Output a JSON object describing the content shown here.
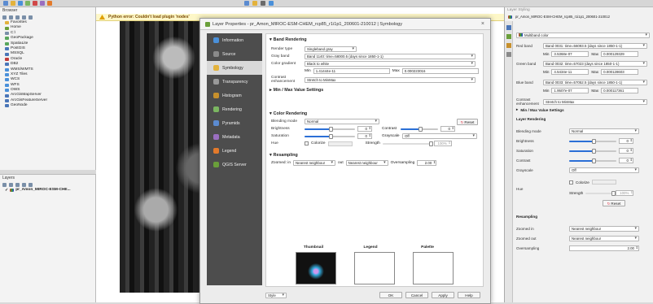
{
  "error_bar": {
    "text": "Python error: Couldn't load plugin 'nodes'"
  },
  "browser": {
    "title": "Browser",
    "items": [
      "Favorites",
      "Home",
      "C:\\",
      "GeoPackage",
      "SpatiaLite",
      "PostGIS",
      "MSSQL",
      "Oracle",
      "DB2",
      "WMS/WMTS",
      "XYZ Tiles",
      "WCS",
      "WFS",
      "OWS",
      "ArcGisMapServer",
      "ArcGisFeatureServer",
      "GeoNode"
    ]
  },
  "layers": {
    "title": "Layers",
    "layer_name": "pr_Amon_MIROC-ESM-CHE..."
  },
  "dialog": {
    "title": "Layer Properties - pr_Amon_MIROC-ESM-CHEM_rcp85_r1i1p1_200601-210012 | Symbology",
    "close": "×",
    "sidebar": [
      "Information",
      "Source",
      "Symbology",
      "Transparency",
      "Histogram",
      "Rendering",
      "Pyramids",
      "Metadata",
      "Legend",
      "QGIS Server"
    ],
    "band_rendering": {
      "header": "Band Rendering",
      "render_type_label": "Render type",
      "render_type": "Singleband gray",
      "gray_band_label": "Gray band",
      "gray_band": "Band 1140: time=58000.5 (days since 1850-1-1)",
      "color_gradient_label": "Color gradient",
      "color_gradient": "Black to white",
      "min_label": "Min",
      "min": "1.41444e-11",
      "max_label": "Max",
      "max": "0.000223016",
      "contrast_label": "Contrast enhancement",
      "contrast": "Stretch to MinMax"
    },
    "minmax": {
      "header": "Min / Max Value Settings"
    },
    "color_rendering": {
      "header": "Color Rendering",
      "blend_label": "Blending mode",
      "blend": "Normal",
      "reset": "Reset",
      "brightness_label": "Brightness",
      "brightness": "0",
      "contrast_label": "Contrast",
      "contrast": "0",
      "saturation_label": "Saturation",
      "saturation": "0",
      "grayscale_label": "Grayscale",
      "grayscale": "Off",
      "hue_label": "Hue",
      "colorize_label": "Colorize",
      "strength_label": "Strength",
      "strength": "100%"
    },
    "resampling": {
      "header": "Resampling",
      "zoomed_in_label": "Zoomed: in",
      "zoomed_in": "Nearest neighbour",
      "zoomed_out_label": "out",
      "zoomed_out": "Nearest neighbour",
      "oversampling_label": "Oversampling",
      "oversampling": "2.00"
    },
    "previews": {
      "thumbnail": "Thumbnail",
      "legend": "Legend",
      "palette": "Palette"
    },
    "footer": {
      "style": "Style",
      "ok": "OK",
      "cancel": "Cancel",
      "apply": "Apply",
      "help": "Help"
    }
  },
  "style_panel": {
    "title": "Layer Styling",
    "layer": "pr_Amon_MIROC-ESM-CHEM_rcp85_r1i1p1_200601-210012",
    "renderer": "Multiband color",
    "red_band_label": "Red band",
    "red_band": "Band 0031: time=56093.5 (days since 1850-1-1)",
    "red_min_label": "Min",
    "red_min": "3.5368e-07",
    "red_max_label": "Max",
    "red_max": "0.000129329",
    "green_band_label": "Green band",
    "green_band": "Band 0032: time=57023 (days since 1850-1-1)",
    "green_min_label": "Min",
    "green_min": "4.5434e-11",
    "green_max_label": "Max",
    "green_max": "0.000128603",
    "blue_band_label": "Blue band",
    "blue_band": "Band 0033: time=57052.5 (days since 1850-1-1)",
    "blue_min_label": "Min",
    "blue_min": "1.9507e-07",
    "blue_max_label": "Max",
    "blue_max": "0.000117361",
    "contrast_label": "Contrast enhancement",
    "contrast": "Stretch to MinMax",
    "minmax_header": "Min / Max Value Settings",
    "layer_rendering_header": "Layer Rendering",
    "blend_label": "Blending mode",
    "blend": "Normal",
    "brightness_label": "Brightness",
    "brightness": "0",
    "saturation_label": "Saturation",
    "saturation": "0",
    "contrast2_label": "Contrast",
    "contrast2": "0",
    "grayscale_label": "Grayscale",
    "grayscale": "Off",
    "hue_label": "Hue",
    "colorize_label": "Colorize",
    "strength_label": "Strength",
    "strength": "100%",
    "reset": "Reset",
    "resampling_header": "Resampling",
    "zoomed_in_label": "Zoomed in",
    "zoomed_in": "Nearest neighbour",
    "zoomed_out_label": "Zoomed out",
    "zoomed_out": "Nearest neighbour",
    "oversampling_label": "Oversampling",
    "oversampling": "2.00"
  }
}
